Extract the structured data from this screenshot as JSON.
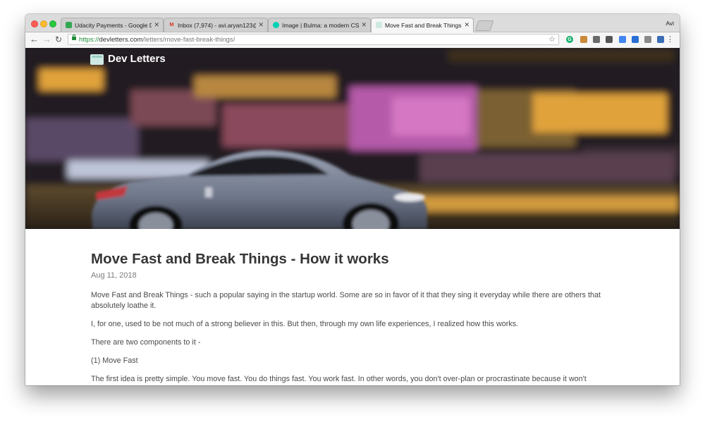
{
  "browser": {
    "tabs": [
      {
        "title": "Udacity Payments - Google D",
        "favicon": "drive-icon",
        "color": "#34a853"
      },
      {
        "title": "Inbox (7,974) - avi.aryan123@",
        "favicon": "gmail-icon",
        "color": "#d93025"
      },
      {
        "title": "Image | Bulma: a modern CSS",
        "favicon": "bulma-icon",
        "color": "#00d1b2"
      },
      {
        "title": "Move Fast and Break Things -",
        "favicon": "envelope-icon",
        "color": "#9bcfc3"
      }
    ],
    "profile_name": "Avi",
    "url": {
      "scheme": "https://",
      "host": "devletters.com",
      "path": "/letters/move-fast-break-things/"
    }
  },
  "site": {
    "name": "Dev Letters"
  },
  "post": {
    "title": "Move Fast and Break Things - How it works",
    "date": "Aug 11, 2018",
    "paragraphs": [
      "Move Fast and Break Things - such a popular saying in the startup world. Some are so in favor of it that they sing it everyday while there are others that absolutely loathe it.",
      "I, for one, used to be not much of a strong believer in this. But then, through my own life experiences, I realized how this works.",
      "There are two components to it -",
      "(1) Move Fast",
      "The first idea is pretty simple. You move fast. You do things fast. You work fast. In other words, you don't over-plan or procrastinate because it won't"
    ]
  },
  "colors": {
    "accent_green": "#1f8d3a",
    "title_text": "#363636",
    "body_text": "#4a4a4a"
  }
}
